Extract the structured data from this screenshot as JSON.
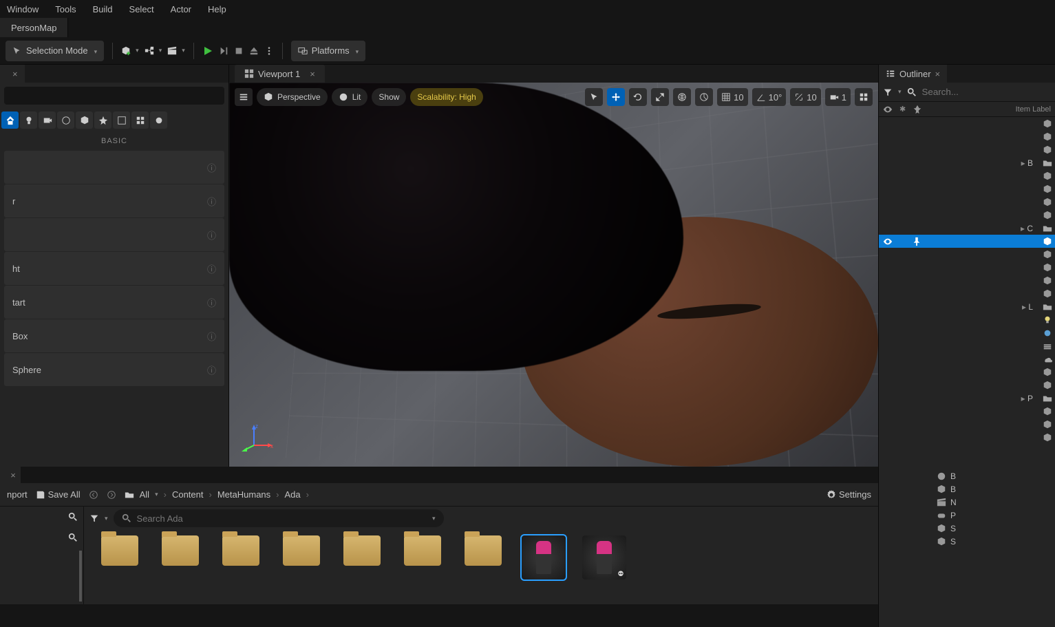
{
  "menu": {
    "items": [
      "Window",
      "Tools",
      "Build",
      "Select",
      "Actor",
      "Help"
    ]
  },
  "map_tab": "PersonMap",
  "toolbar": {
    "selection_mode": "Selection Mode",
    "platforms": "Platforms"
  },
  "left_panel": {
    "category": "BASIC",
    "items": [
      "",
      "r",
      "",
      "ht",
      "tart",
      "Box",
      "Sphere"
    ]
  },
  "viewport": {
    "tab": "Viewport 1",
    "perspective": "Perspective",
    "lit": "Lit",
    "show": "Show",
    "scalability": "Scalability: High",
    "grid": "10",
    "angle": "10°",
    "scale": "10",
    "cam": "1"
  },
  "outliner": {
    "title": "Outliner",
    "search_ph": "Search...",
    "header": "Item Label",
    "folders": {
      "b": "B",
      "c": "C",
      "l": "L",
      "p": "P"
    }
  },
  "content": {
    "import": "nport",
    "save_all": "Save All",
    "all": "All",
    "crumbs": [
      "Content",
      "MetaHumans",
      "Ada"
    ],
    "settings": "Settings",
    "search_ph": "Search Ada",
    "folders_count": 7
  },
  "right_lower_labels": [
    "B",
    "B",
    "N",
    "P",
    "S",
    "S"
  ]
}
